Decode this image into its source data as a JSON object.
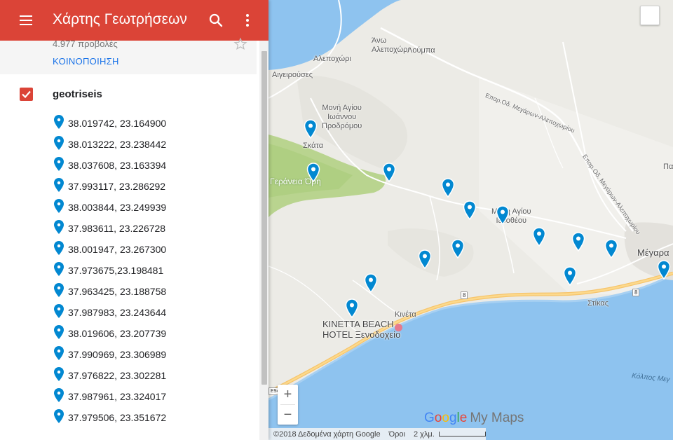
{
  "app": {
    "title": "Χάρτης Γεωτρήσεων",
    "views": "4.977 προβολές",
    "share": "ΚΟΙΝΟΠΟΙΗΣΗ"
  },
  "layer": {
    "name": "geotriseis",
    "checked": true
  },
  "items": [
    "38.019742, 23.164900",
    "38.013222, 23.238442",
    "38.037608, 23.163394",
    "37.993117, 23.286292",
    "38.003844, 23.249939",
    "37.983611, 23.226728",
    "38.001947, 23.267300",
    "37.973675,23.198481",
    "37.963425, 23.188758",
    "37.987983, 23.243644",
    "38.019606, 23.207739",
    "37.990969, 23.306989",
    "37.976822, 23.302281",
    "37.987961, 23.324017",
    "37.979506, 23.351672"
  ],
  "map": {
    "labels": {
      "ano_alepochori": "Άνω\nΑλεποχώρι",
      "loumpa": "Λούμπα",
      "alepochori": "Αλεποχώρι",
      "aigeirouses": "Αιγειρούσες",
      "moni_ioannou": "Μονή Αγίου\nΙωάννου\nΠροδρόμου",
      "skata": "Σκάτα",
      "geraneia": "Γεράνεια Όρη",
      "moni_ierotheou": "Μόνη Αγίου\nΙεροθέου",
      "megara": "Μέγαρα",
      "pa": "Πα",
      "stikas": "Στίκας",
      "kineta": "Κινέτα",
      "hotel": "KINETTA BEACH\nHOTEL Ξενοδοχείο",
      "road1": "Επαρ.Οδ. Μεγάρων-Αλεποχωρίου",
      "road2": "Επαρ.Οδ. Μεγάρων-Αλεποχωρίου",
      "gulf": "Κόλπος Μεγ",
      "shield_8a": "8",
      "shield_8b": "8",
      "shield_e94": "E94"
    },
    "zoom_in": "+",
    "zoom_out": "−",
    "brand_google": [
      "G",
      "o",
      "o",
      "g",
      "l",
      "e"
    ],
    "brand_mymaps": "My Maps",
    "footer_copyright": "©2018 Δεδομένα χάρτη Google",
    "footer_terms": "Όροι",
    "footer_scale": "2 χλμ.",
    "pin_color": "#0288d1",
    "accent_color": "#db4437"
  }
}
